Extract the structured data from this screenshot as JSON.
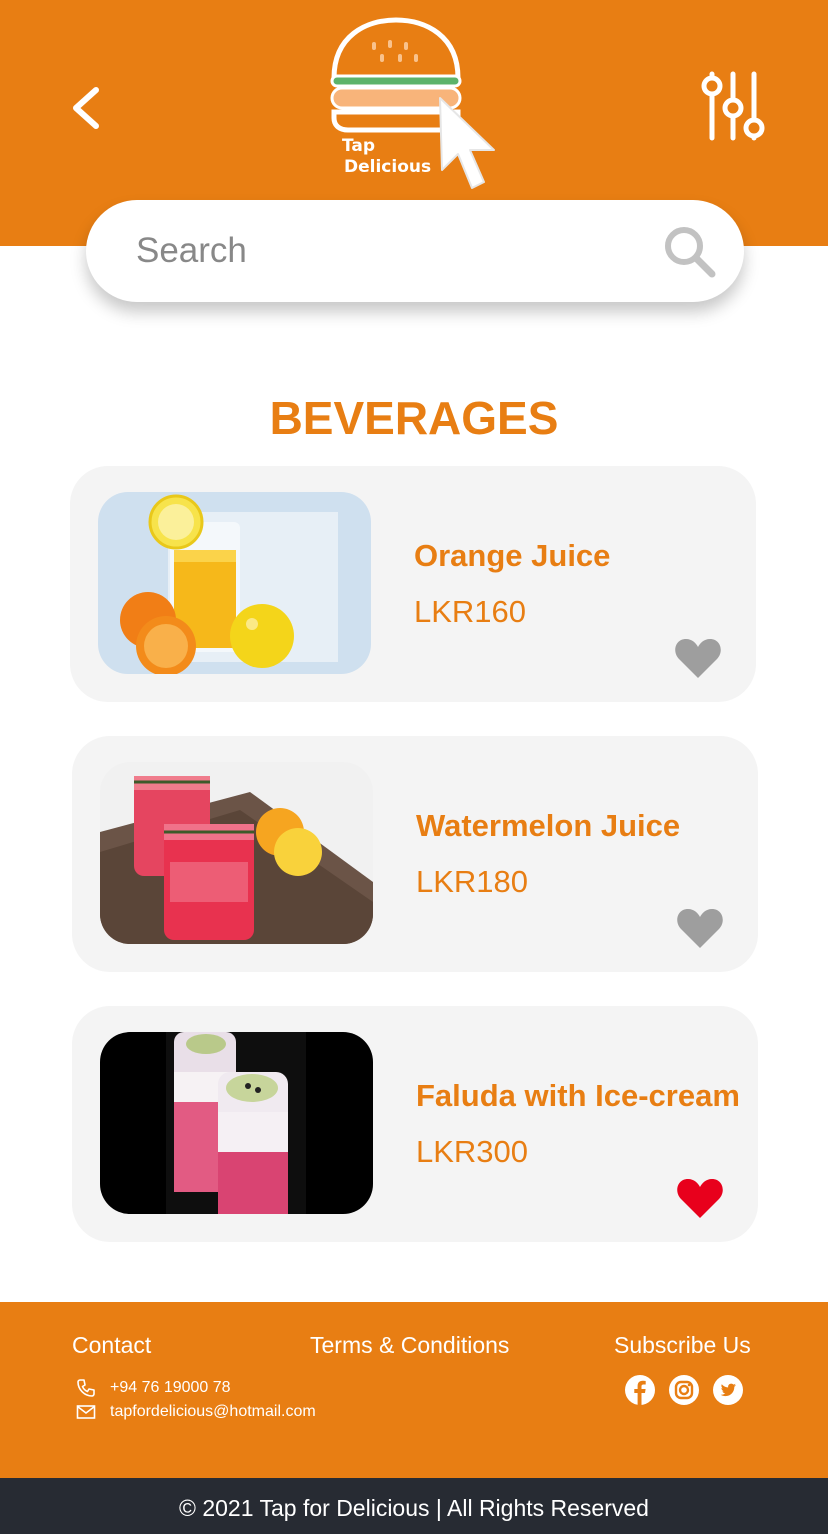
{
  "header": {
    "logo_line1": "Tap",
    "logo_line2": "Delicious",
    "back_icon": "chevron-left-icon",
    "filter_icon": "sliders-icon"
  },
  "search": {
    "placeholder": "Search",
    "value": "",
    "icon": "search-icon"
  },
  "section": {
    "title": "BEVERAGES"
  },
  "items": [
    {
      "name": "Orange Juice",
      "price": "LKR160",
      "favorite": false,
      "image": "orange-juice-photo"
    },
    {
      "name": "Watermelon Juice",
      "price": "LKR180",
      "favorite": false,
      "image": "watermelon-juice-photo"
    },
    {
      "name": "Faluda with Ice-cream",
      "price": "LKR300",
      "favorite": true,
      "image": "faluda-photo"
    }
  ],
  "footer": {
    "contact_title": "Contact",
    "phone": "+94 76 19000 78",
    "email": "tapfordelicious@hotmail.com",
    "terms_label": "Terms & Conditions",
    "subscribe_title": "Subscribe Us",
    "social": [
      "facebook-icon",
      "instagram-icon",
      "twitter-icon"
    ]
  },
  "copyright": "© 2021 Tap for Delicious | All Rights Reserved",
  "colors": {
    "brand_orange": "#e87e13",
    "card_bg": "#f4f4f4",
    "heart_inactive": "#9e9e9e",
    "heart_active": "#e8001c",
    "bottom_bar": "#272b33"
  }
}
